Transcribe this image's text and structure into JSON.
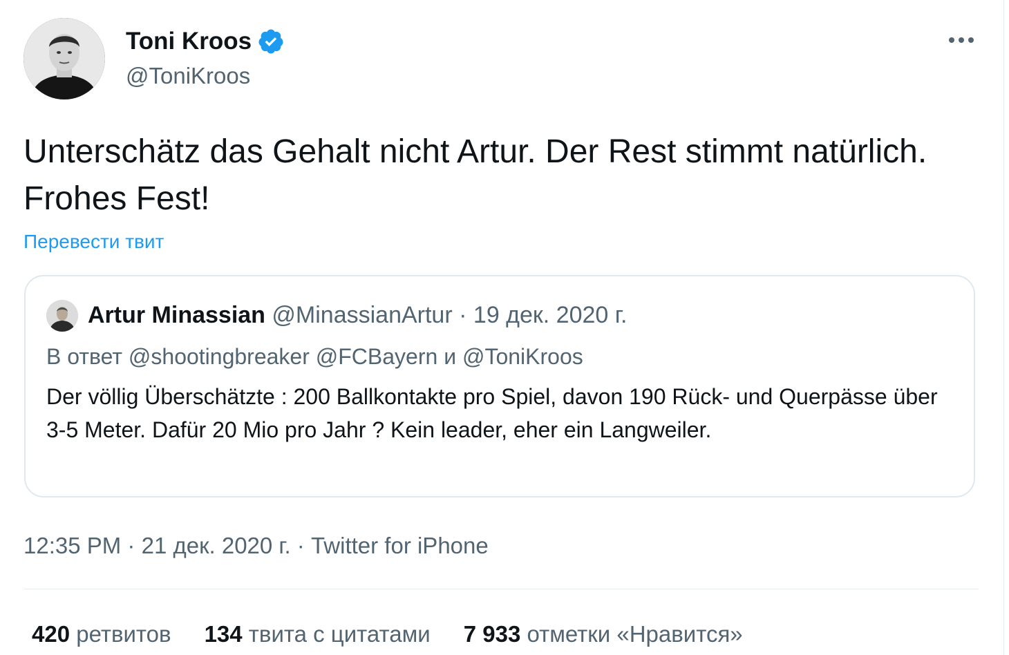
{
  "author": {
    "name": "Toni Kroos",
    "handle": "@ToniKroos",
    "verified": true
  },
  "tweet": {
    "text": "Unterschätz das Gehalt nicht Artur. Der Rest stimmt natürlich. Frohes Fest!",
    "translate_label": "Перевести твит"
  },
  "quoted_tweet": {
    "author_name": "Artur Minassian",
    "author_handle": "@MinassianArtur",
    "separator": "·",
    "date": "19 дек. 2020 г.",
    "reply_prefix": "В ответ",
    "reply_to": [
      "@shootingbreaker",
      "@FCBayern"
    ],
    "reply_and": "и",
    "reply_last": "@ToniKroos",
    "text": "Der völlig Überschätzte : 200 Ballkontakte pro Spiel, davon 190 Rück- und Querpässe über 3-5 Meter. Dafür 20 Mio pro Jahr ? Kein leader, eher ein Langweiler."
  },
  "meta": {
    "time": "12:35 PM",
    "date": "21 дек. 2020 г.",
    "source": "Twitter for iPhone",
    "separator": "·"
  },
  "stats": {
    "retweets_count": "420",
    "retweets_label": "ретвитов",
    "quotes_count": "134",
    "quotes_label": "твита с цитатами",
    "likes_count": "7 933",
    "likes_label": "отметки «Нравится»"
  },
  "colors": {
    "link": "#1d9bf0",
    "secondary_text": "#536471",
    "primary_text": "#0f1419",
    "verified_badge": "#1d9bf0",
    "border": "#e1e8ed"
  },
  "icons": {
    "verified": "verified-badge-icon",
    "more": "more-dots-icon"
  }
}
